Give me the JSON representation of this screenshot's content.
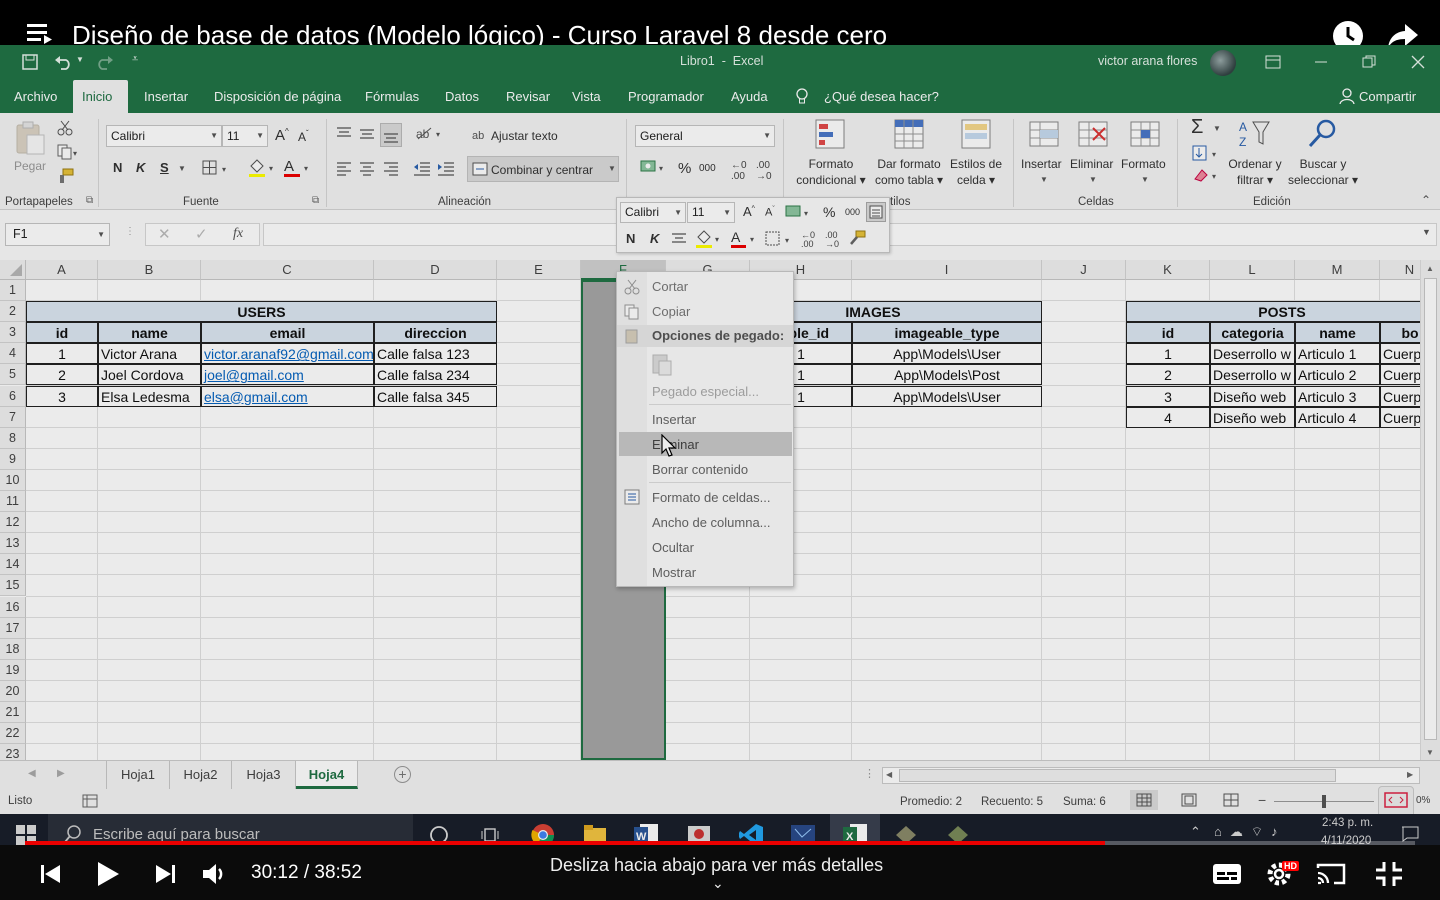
{
  "video": {
    "title": "Diseño de base de datos (Modelo lógico) - Curso Laravel 8 desde cero",
    "time": "30:12 / 38:52",
    "hint": "Desliza hacia abajo para ver más detalles",
    "progress": 0.7769,
    "hd_badge": "HD"
  },
  "excel": {
    "doc_title": "Libro1  -  Excel",
    "user": "victor arana flores",
    "tabs": [
      "Archivo",
      "Inicio",
      "Insertar",
      "Disposición de página",
      "Fórmulas",
      "Datos",
      "Revisar",
      "Vista",
      "Programador",
      "Ayuda"
    ],
    "tell_me": "¿Qué desea hacer?",
    "share": "Compartir",
    "ribbon": {
      "paste": "Pegar",
      "font_name": "Calibri",
      "font_size": "11",
      "bold": "N",
      "italic": "K",
      "underline": "S",
      "wrap_text": "Ajustar texto",
      "merge_center": "Combinar y centrar",
      "number_format": "General",
      "cond_format": [
        "Formato",
        "condicional"
      ],
      "format_table": [
        "Dar formato",
        "como tabla"
      ],
      "cell_styles": [
        "Estilos de",
        "celda"
      ],
      "insert": "Insertar",
      "delete": "Eliminar",
      "format": "Formato",
      "sort_filter": [
        "Ordenar y",
        "filtrar"
      ],
      "find_select": [
        "Buscar y",
        "seleccionar"
      ],
      "groups": [
        "Portapapeles",
        "Fuente",
        "Alineación",
        "Estilos",
        "Celdas",
        "Edición"
      ],
      "group_styles_visible": "tilos",
      "percent": "%",
      "thousands": "000"
    },
    "name_box": "F1",
    "fx": "fx",
    "columns": [
      "A",
      "B",
      "C",
      "D",
      "E",
      "F",
      "G",
      "H",
      "I",
      "J",
      "K",
      "L",
      "M",
      "N"
    ],
    "rows": [
      "1",
      "2",
      "3",
      "4",
      "5",
      "6",
      "7",
      "8",
      "9",
      "10",
      "11",
      "12",
      "13",
      "14",
      "15",
      "16",
      "17",
      "18",
      "19",
      "20",
      "21",
      "22",
      "23"
    ],
    "users_table": {
      "title": "USERS",
      "headers": [
        "id",
        "name",
        "email",
        "direccion"
      ],
      "rows": [
        [
          "1",
          "Victor Arana",
          "victor.aranaf92@gmail.com",
          "Calle falsa 123"
        ],
        [
          "2",
          "Joel Cordova",
          "joel@gmail.com",
          "Calle falsa 234"
        ],
        [
          "3",
          "Elsa Ledesma",
          "elsa@gmail.com",
          "Calle falsa 345"
        ]
      ]
    },
    "images_table": {
      "title": "IMAGES",
      "headers": [
        "eable_id",
        "imageable_type"
      ],
      "rows": [
        [
          "1",
          "App\\Models\\User"
        ],
        [
          "1",
          "App\\Models\\Post"
        ],
        [
          "1",
          "App\\Models\\User"
        ]
      ]
    },
    "posts_table": {
      "title": "POSTS",
      "headers": [
        "id",
        "categoria",
        "name",
        "bo"
      ],
      "rows": [
        [
          "1",
          "Deserrollo w",
          "Articulo 1",
          "Cuerp"
        ],
        [
          "2",
          "Deserrollo w",
          "Articulo 2",
          "Cuerp"
        ],
        [
          "3",
          "Diseño web",
          "Articulo 3",
          "Cuerp"
        ],
        [
          "4",
          "Diseño web",
          "Articulo 4",
          "Cuerp"
        ]
      ]
    },
    "mini_toolbar": {
      "font": "Calibri",
      "size": "11",
      "bold": "N",
      "italic": "K"
    },
    "context_menu": {
      "cut": "Cortar",
      "copy": "Copiar",
      "paste_options": "Opciones de pegado:",
      "paste_special": "Pegado especial...",
      "insert": "Insertar",
      "delete": "Eliminar",
      "clear": "Borrar contenido",
      "format_cells": "Formato de celdas...",
      "col_width": "Ancho de columna...",
      "hide": "Ocultar",
      "show": "Mostrar"
    },
    "sheets": [
      "Hoja1",
      "Hoja2",
      "Hoja3",
      "Hoja4"
    ],
    "active_sheet": "Hoja4",
    "status": {
      "ready": "Listo",
      "average": "Promedio: 2",
      "count": "Recuento: 5",
      "sum": "Suma: 6",
      "zoom": "0%"
    }
  },
  "taskbar": {
    "search": "Escribe aquí para buscar",
    "time": "2:43 p. m.",
    "date": "4/11/2020"
  },
  "colors": {
    "excel_green": "#217346",
    "table_header_fill": "#dce6f1",
    "selection_fill": "#a6a6a6",
    "link": "#0563c1",
    "yt_red": "#ff0000"
  }
}
